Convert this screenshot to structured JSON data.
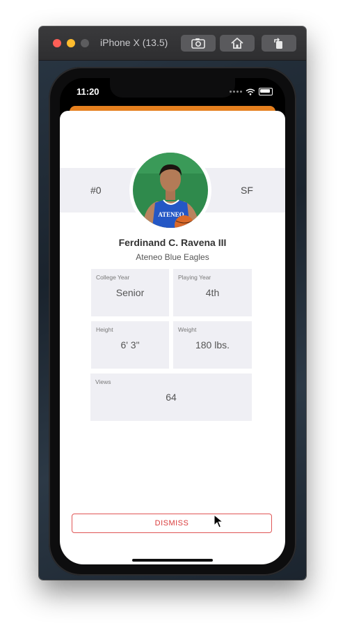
{
  "window": {
    "title": "iPhone X (13.5)",
    "buttons": [
      "screenshot-icon",
      "home-icon",
      "rotate-icon"
    ]
  },
  "status_bar": {
    "time": "11:20"
  },
  "player": {
    "number": "#0",
    "position": "SF",
    "name": "Ferdinand C. Ravena III",
    "team": "Ateneo Blue Eagles",
    "jersey_text": "ATENEO"
  },
  "stats": {
    "college_year": {
      "label": "College Year",
      "value": "Senior"
    },
    "playing_year": {
      "label": "Playing Year",
      "value": "4th"
    },
    "height": {
      "label": "Height",
      "value": "6' 3\""
    },
    "weight": {
      "label": "Weight",
      "value": "180 lbs."
    },
    "views": {
      "label": "Views",
      "value": "64"
    }
  },
  "actions": {
    "dismiss_label": "DISMISS"
  },
  "colors": {
    "accent_orange": "#e6801f",
    "dismiss_red": "#d93a3a",
    "card_bg": "#efeff4"
  }
}
